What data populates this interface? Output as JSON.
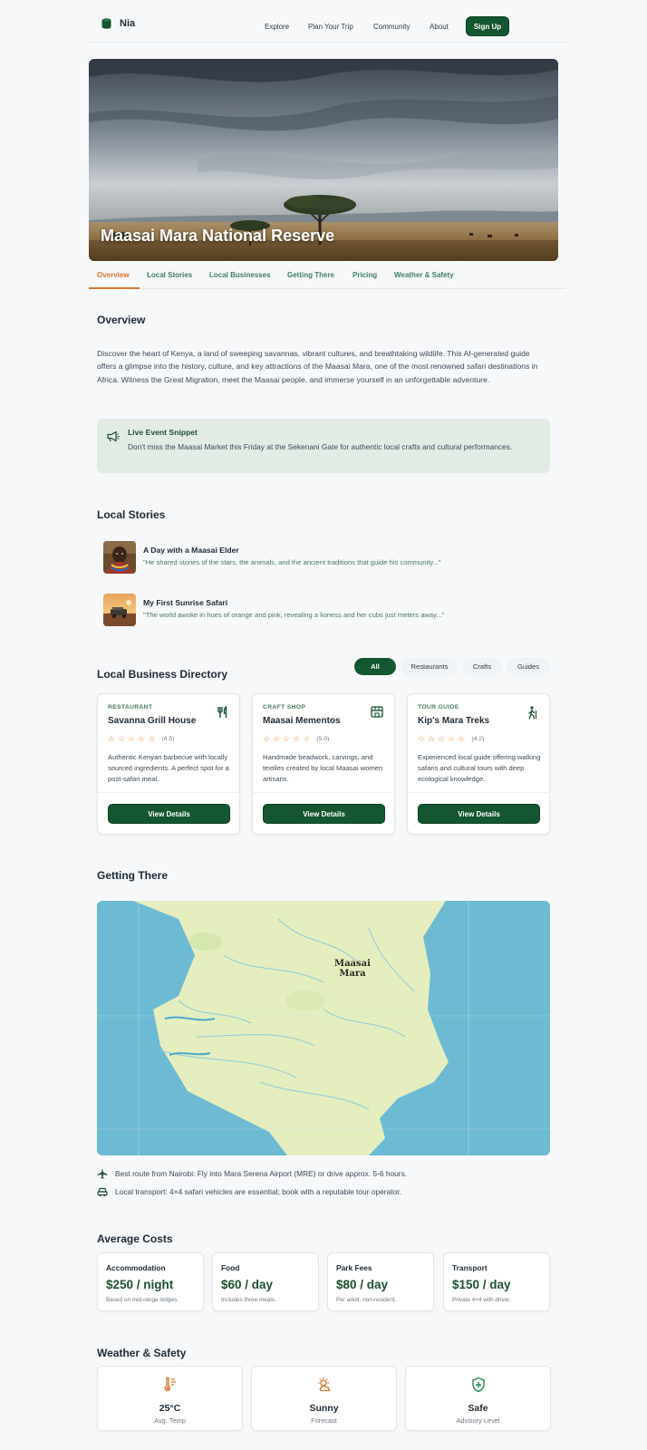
{
  "header": {
    "brand": "Nia",
    "nav": [
      "Explore",
      "Plan Your Trip",
      "Community",
      "About"
    ],
    "signup_label": "Sign Up"
  },
  "hero": {
    "title": "Maasai Mara National Reserve"
  },
  "tabs": [
    "Overview",
    "Local Stories",
    "Local Businesses",
    "Getting There",
    "Pricing",
    "Weather & Safety"
  ],
  "active_tab": "Overview",
  "overview": {
    "heading": "Overview",
    "text": "Discover the heart of Kenya, a land of sweeping savannas, vibrant cultures, and breathtaking wildlife. This AI-generated guide offers a glimpse into the history, culture, and key attractions of the Maasai Mara, one of the most renowned safari destinations in Africa. Witness the Great Migration, meet the Maasai people, and immerse yourself in an unforgettable adventure."
  },
  "event": {
    "icon": "megaphone-icon",
    "title": "Live Event Snippet",
    "text": "Don't miss the Maasai Market this Friday at the Sekenani Gate for authentic local crafts and cultural performances."
  },
  "stories": {
    "heading": "Local Stories",
    "items": [
      {
        "title": "A Day with a Maasai Elder",
        "quote": "\"He shared stories of the stars, the animals, and the ancient traditions that guide his community...\""
      },
      {
        "title": "My First Sunrise Safari",
        "quote": "\"The world awoke in hues of orange and pink, revealing a lioness and her cubs just meters away...\""
      }
    ]
  },
  "directory": {
    "heading": "Local Business Directory",
    "filters": [
      "All",
      "Restaurants",
      "Crafts",
      "Guides"
    ],
    "active_filter": "All",
    "businesses": [
      {
        "category": "RESTAURANT",
        "name": "Savanna Grill House",
        "icon": "fork-knife-icon",
        "rating": 4.5,
        "rating_text": "(4.5)",
        "description": "Authentic Kenyan barbecue with locally sourced ingredients. A perfect spot for a post-safari meal.",
        "button": "View Details"
      },
      {
        "category": "CRAFT SHOP",
        "name": "Maasai Mementos",
        "icon": "storefront-icon",
        "rating": 5.0,
        "rating_text": "(5.0)",
        "description": "Handmade beadwork, carvings, and textiles created by local Maasai women artisans.",
        "button": "View Details"
      },
      {
        "category": "TOUR GUIDE",
        "name": "Kip's Mara Treks",
        "icon": "hiker-icon",
        "rating": 4.2,
        "rating_text": "(4.2)",
        "description": "Experienced local guide offering walking safaris and cultural tours with deep ecological knowledge.",
        "button": "View Details"
      }
    ]
  },
  "getting_there": {
    "heading": "Getting There",
    "map_label_line1": "Maasai",
    "map_label_line2": "Mara",
    "routes": [
      {
        "icon": "airplane-icon",
        "text": "Best route from Nairobi: Fly into Mara Serena Airport (MRE) or drive approx. 5-6 hours."
      },
      {
        "icon": "car-icon",
        "text": "Local transport: 4×4 safari vehicles are essential; book with a reputable tour operator."
      }
    ]
  },
  "costs": {
    "heading": "Average Costs",
    "items": [
      {
        "label": "Accommodation",
        "value": "$250 / night",
        "note": "Based on mid-range lodges."
      },
      {
        "label": "Food",
        "value": "$60 / day",
        "note": "Includes three meals."
      },
      {
        "label": "Park Fees",
        "value": "$80 / day",
        "note": "Per adult, non-resident."
      },
      {
        "label": "Transport",
        "value": "$150 / day",
        "note": "Private 4×4 with driver."
      }
    ]
  },
  "weather": {
    "heading": "Weather & Safety",
    "items": [
      {
        "icon": "thermometer-icon",
        "value": "25°C",
        "label": "Avg. Temp"
      },
      {
        "icon": "sun-cloud-icon",
        "value": "Sunny",
        "label": "Forecast"
      },
      {
        "icon": "shield-plus-icon",
        "value": "Safe",
        "label": "Advisory Level"
      }
    ]
  },
  "colors": {
    "brand_green": "#14562f",
    "accent_orange": "#d9772d",
    "tab_green": "#3f7e5b"
  }
}
